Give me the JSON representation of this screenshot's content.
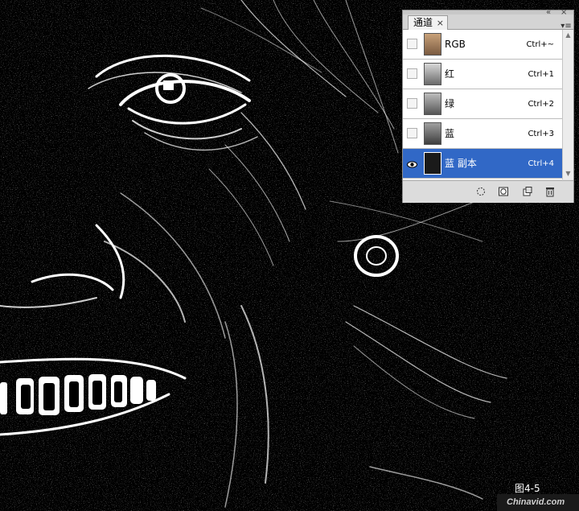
{
  "panel": {
    "tab_label": "通道",
    "tab_close": "×",
    "collapse_glyph": "«",
    "close_glyph": "×",
    "menu_glyph": "▾≡",
    "channels": [
      {
        "name": "RGB",
        "shortcut": "Ctrl+~",
        "visible": false,
        "selected": false
      },
      {
        "name": "红",
        "shortcut": "Ctrl+1",
        "visible": false,
        "selected": false
      },
      {
        "name": "绿",
        "shortcut": "Ctrl+2",
        "visible": false,
        "selected": false
      },
      {
        "name": "蓝",
        "shortcut": "Ctrl+3",
        "visible": false,
        "selected": false
      },
      {
        "name": "蓝 副本",
        "shortcut": "Ctrl+4",
        "visible": true,
        "selected": true
      }
    ],
    "bottom_icons": [
      "load-selection-icon",
      "save-selection-icon",
      "new-channel-icon",
      "delete-channel-icon"
    ]
  },
  "caption": "图4-5",
  "watermark": "Chinavid.com",
  "colors": {
    "selection": "#3168c6",
    "background": "#000000"
  }
}
